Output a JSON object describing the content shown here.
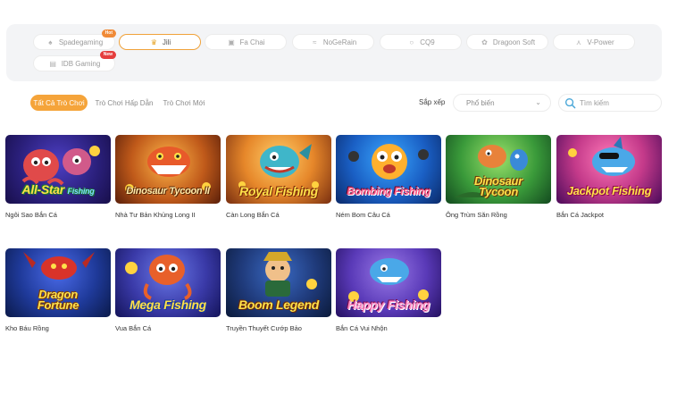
{
  "providers": [
    {
      "label": "Spadegaming",
      "icon": "spade-logo-icon",
      "badge": "Hot",
      "active": false
    },
    {
      "label": "Jili",
      "icon": "jili-crown-icon",
      "active": true
    },
    {
      "label": "Fa Chai",
      "icon": "fachai-logo-icon",
      "active": false
    },
    {
      "label": "NoGeRain",
      "icon": "wave-logo-icon",
      "active": false
    },
    {
      "label": "CQ9",
      "icon": "cq9-logo-icon",
      "active": false
    },
    {
      "label": "Dragoon Soft",
      "icon": "dragon-logo-icon",
      "active": false
    },
    {
      "label": "V-Power",
      "icon": "vpower-logo-icon",
      "active": false
    },
    {
      "label": "IDB Gaming",
      "icon": "idb-logo-icon",
      "badge": "New",
      "active": false
    }
  ],
  "tabs": [
    {
      "label": "Tất Cả Trò Chơi",
      "active": true
    },
    {
      "label": "Trò Chơi Hấp Dẫn",
      "active": false
    },
    {
      "label": "Trò Chơi Mới",
      "active": false
    }
  ],
  "sort": {
    "label": "Sắp xếp",
    "value": "Phổ biến"
  },
  "search": {
    "placeholder": "Tìm kiếm"
  },
  "games": [
    {
      "name": "Ngôi Sao Bắn Cá",
      "title": "All-Star",
      "subtitle": "Fishing"
    },
    {
      "name": "Nhà Tư Bản Khủng Long II",
      "title": "Dinosaur Tycoon",
      "subtitle": "II"
    },
    {
      "name": "Càn Long Bắn Cá",
      "title": "Royal Fishing",
      "subtitle": ""
    },
    {
      "name": "Ném Bom Câu Cá",
      "title": "Bombing Fishing",
      "subtitle": ""
    },
    {
      "name": "Ông Trùm Săn Rồng",
      "title": "Dinosaur",
      "subtitle": "Tycoon"
    },
    {
      "name": "Bắn Cá Jackpot",
      "title": "Jackpot Fishing",
      "subtitle": ""
    },
    {
      "name": "Kho Báu Rồng",
      "title": "Dragon",
      "subtitle": "Fortune"
    },
    {
      "name": "Vua Bắn Cá",
      "title": "Mega Fishing",
      "subtitle": ""
    },
    {
      "name": "Truyền Thuyết Cướp Bảo",
      "title": "Boom Legend",
      "subtitle": ""
    },
    {
      "name": "Bắn Cá Vui Nhộn",
      "title": "Happy Fishing",
      "subtitle": ""
    }
  ],
  "colors": {
    "accent": "#f5a43a",
    "panel": "#f3f4f6"
  }
}
